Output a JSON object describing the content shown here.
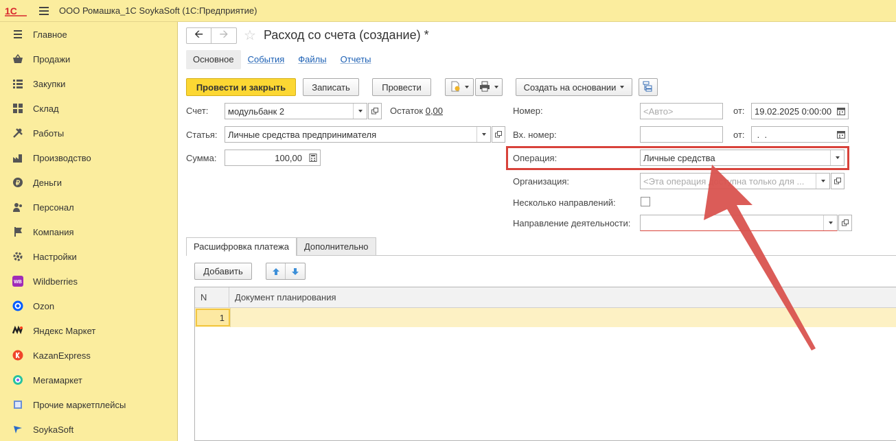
{
  "app": {
    "title": "ООО Ромашка_1С SoykaSoft  (1С:Предприятие)",
    "logo_text": "1С"
  },
  "sidebar": {
    "items": [
      {
        "label": "Главное",
        "icon": "menu-lines-icon"
      },
      {
        "label": "Продажи",
        "icon": "basket-icon"
      },
      {
        "label": "Закупки",
        "icon": "list-icon"
      },
      {
        "label": "Склад",
        "icon": "grid-icon"
      },
      {
        "label": "Работы",
        "icon": "tools-icon"
      },
      {
        "label": "Производство",
        "icon": "factory-icon"
      },
      {
        "label": "Деньги",
        "icon": "ruble-coin-icon"
      },
      {
        "label": "Персонал",
        "icon": "people-icon"
      },
      {
        "label": "Компания",
        "icon": "flag-icon"
      },
      {
        "label": "Настройки",
        "icon": "gear-icon"
      },
      {
        "label": "Wildberries",
        "icon": "wildberries-icon"
      },
      {
        "label": "Ozon",
        "icon": "ozon-icon"
      },
      {
        "label": "Яндекс Маркет",
        "icon": "yandex-market-icon"
      },
      {
        "label": "KazanExpress",
        "icon": "kazanexpress-icon"
      },
      {
        "label": "Мегамаркет",
        "icon": "megamarket-icon"
      },
      {
        "label": "Прочие маркетплейсы",
        "icon": "marketplaces-icon"
      },
      {
        "label": "SoykaSoft",
        "icon": "soykasoft-icon"
      }
    ],
    "wb_badge": "WB"
  },
  "document": {
    "title": "Расход со счета (создание) *",
    "tabs": [
      "Основное",
      "События",
      "Файлы",
      "Отчеты"
    ]
  },
  "toolbar": {
    "post_close": "Провести и закрыть",
    "save": "Записать",
    "post": "Провести",
    "create_based": "Создать на основании"
  },
  "form": {
    "account_label": "Счет:",
    "account_value": "модульбанк 2",
    "balance_label": "Остаток",
    "balance_value": "0,00",
    "item_label": "Статья:",
    "item_value": "Личные средства предпринимателя",
    "sum_label": "Сумма:",
    "sum_value": "100,00",
    "number_label": "Номер:",
    "number_placeholder": "<Авто>",
    "date_from_label": "от:",
    "date_value": "19.02.2025  0:00:00",
    "in_number_label": "Вх. номер:",
    "in_number_value": "",
    "in_date_label": "от:",
    "in_date_value": " .  .",
    "operation_label": "Операция:",
    "operation_value": "Личные средства",
    "org_label": "Организация:",
    "org_placeholder": "<Эта операция доступна только для ...",
    "multi_dir_label": "Несколько направлений:",
    "direction_label": "Направление деятельности:",
    "direction_value": ""
  },
  "bottom_tabs": [
    "Расшифровка платежа",
    "Дополнительно"
  ],
  "table": {
    "add_button": "Добавить",
    "columns": [
      "N",
      "Документ планирования"
    ],
    "rows": [
      {
        "n": "1",
        "doc": ""
      }
    ]
  },
  "colors": {
    "sidebar_bg": "#fbed9e",
    "primary_button": "#fcd733",
    "highlight_frame": "#d8423a",
    "arrow": "#d9534f"
  }
}
